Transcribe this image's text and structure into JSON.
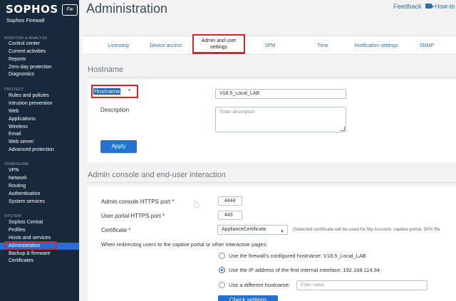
{
  "brand": {
    "name": "SOPHOS",
    "badge": "Fw",
    "product": "Sophos Firewall"
  },
  "sidebar": {
    "sections": [
      {
        "label": "MONITOR & ANALYZE",
        "items": [
          "Control center",
          "Current activities",
          "Reports",
          "Zero-day protection",
          "Diagnostics"
        ]
      },
      {
        "label": "PROTECT",
        "items": [
          "Rules and policies",
          "Intrusion prevention",
          "Web",
          "Applications",
          "Wireless",
          "Email",
          "Web server",
          "Advanced protection"
        ]
      },
      {
        "label": "CONFIGURE",
        "items": [
          "VPN",
          "Network",
          "Routing",
          "Authentication",
          "System services"
        ]
      },
      {
        "label": "SYSTEM",
        "items": [
          "Sophos Central",
          "Profiles",
          "Hosts and services",
          "Administration",
          "Backup & firmware",
          "Certificates"
        ]
      }
    ],
    "active_item": "Administration"
  },
  "header": {
    "title": "Administration",
    "feedback": "Feedback",
    "howto": "How-to"
  },
  "tabs": [
    {
      "label": "Licensing"
    },
    {
      "label": "Device access"
    },
    {
      "label": "Admin and user settings",
      "line1": "Admin and user",
      "line2": "settings",
      "active": true
    },
    {
      "label": "SFM"
    },
    {
      "label": "Time"
    },
    {
      "label": "Notification settings"
    },
    {
      "label": "SNMP"
    }
  ],
  "hostname_section": {
    "heading": "Hostname",
    "hostname_label": "Hostname",
    "required_mark": "*",
    "hostname_value": "V18.5_Local_LAB",
    "description_label": "Description",
    "description_placeholder": "Enter description",
    "apply_label": "Apply"
  },
  "admin_console_section": {
    "heading": "Admin console and end-user interaction",
    "https_port_label": "Admin console HTTPS port *",
    "https_port_value": "4444",
    "user_portal_label": "User portal HTTPS port *",
    "user_portal_value": "443",
    "certificate_label": "Certificate *",
    "certificate_value": "ApplianceCertificate",
    "certificate_hint": "(Selected certificate will be used for My Account, captive portal, SPX Re",
    "redirect_label": "When redirecting users to the captive portal or other interactive pages:",
    "radio_options": [
      {
        "label": "Use the firewall's configured hostname:",
        "value": "V18.5_Local_LAB",
        "checked": false
      },
      {
        "label": "Use the IP address of the first internal interface:",
        "value": "192.168.114.34",
        "checked": true
      },
      {
        "label": "Use a different hostname:",
        "value": "",
        "checked": false
      }
    ],
    "different_hostname_placeholder": "Enter value",
    "check_settings_label": "Check settings"
  }
}
